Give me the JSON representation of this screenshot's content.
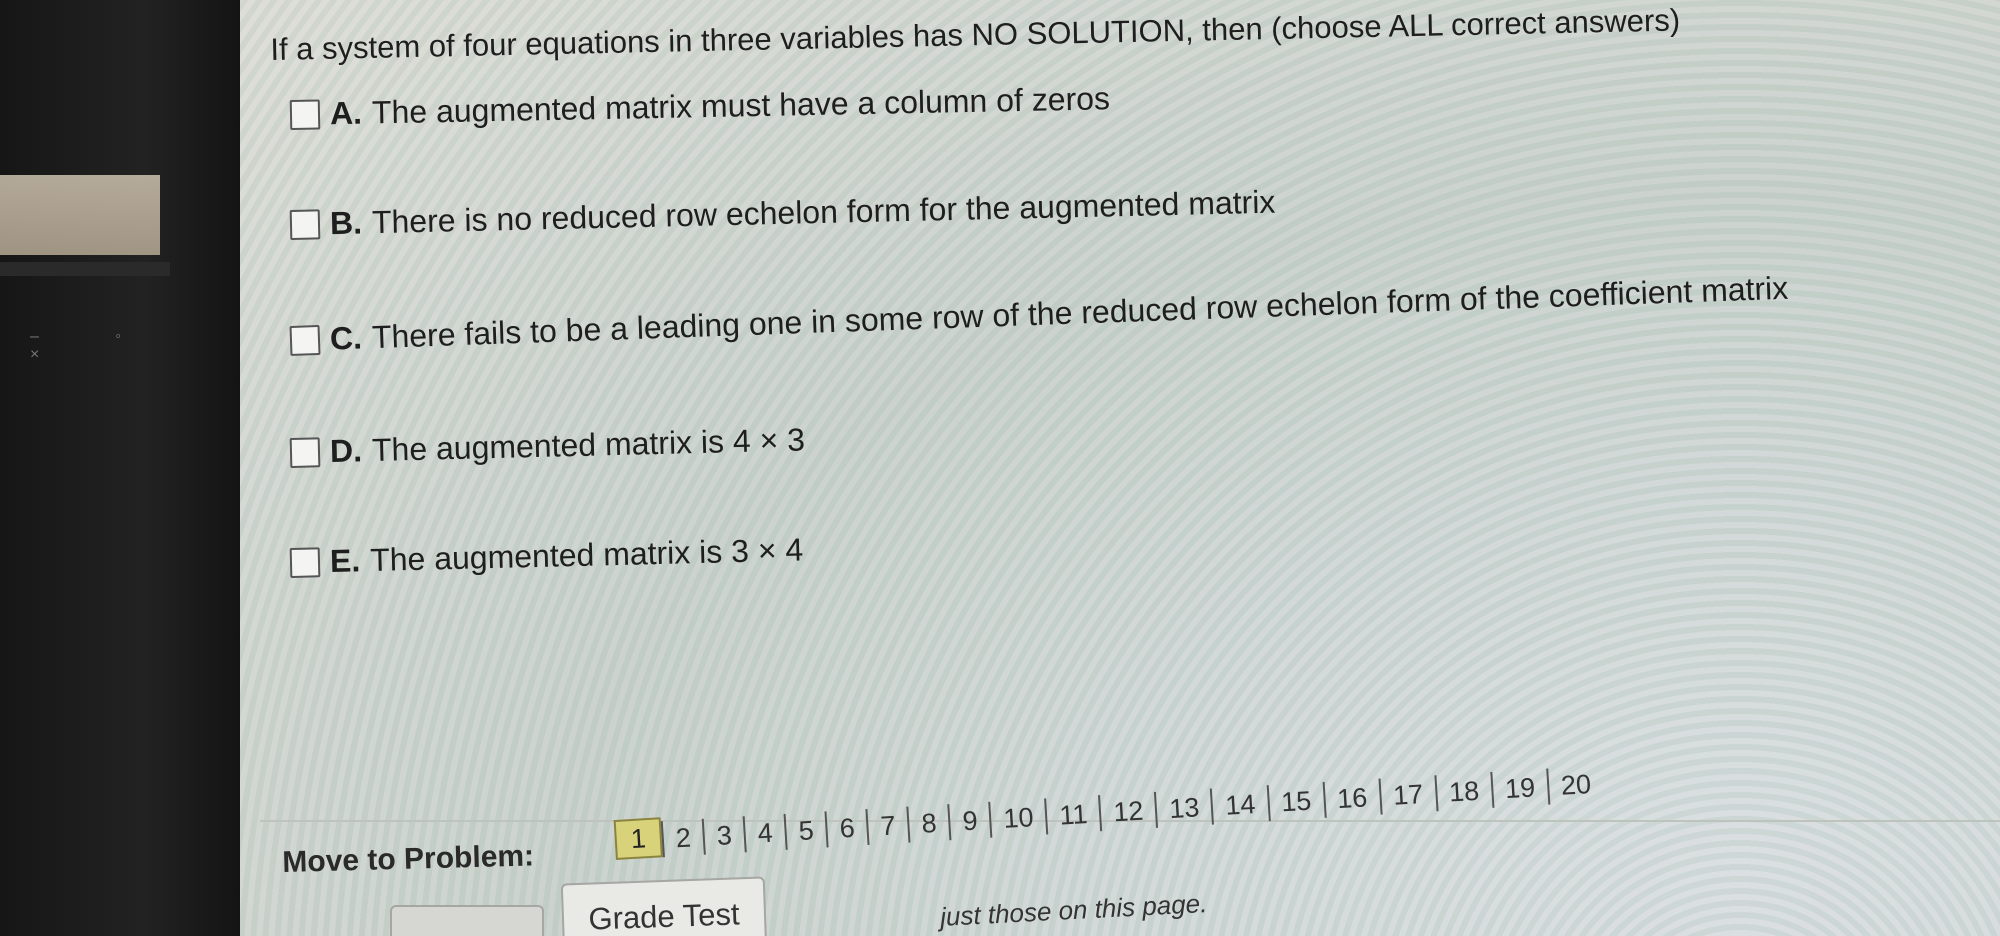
{
  "question": {
    "prompt": "If a system of four equations in three variables has NO SOLUTION, then (choose ALL correct answers)"
  },
  "options": [
    {
      "letter": "A.",
      "text": "The augmented matrix must have a column of zeros"
    },
    {
      "letter": "B.",
      "text": "There is no reduced row echelon form for the augmented matrix"
    },
    {
      "letter": "C.",
      "text": "There fails to be a leading one in some row of the reduced row echelon form of the coefficient matrix"
    },
    {
      "letter": "D.",
      "text": "The augmented matrix is 4 × 3"
    },
    {
      "letter": "E.",
      "text": "The augmented matrix is 3 × 4"
    }
  ],
  "navigation": {
    "label": "Move to Problem:",
    "current": "1",
    "pages": [
      "1",
      "2",
      "3",
      "4",
      "5",
      "6",
      "7",
      "8",
      "9",
      "10",
      "11",
      "12",
      "13",
      "14",
      "15",
      "16",
      "17",
      "18",
      "19",
      "20"
    ]
  },
  "actions": {
    "grade_label": "Grade Test"
  },
  "footer_note": "just those on this page."
}
